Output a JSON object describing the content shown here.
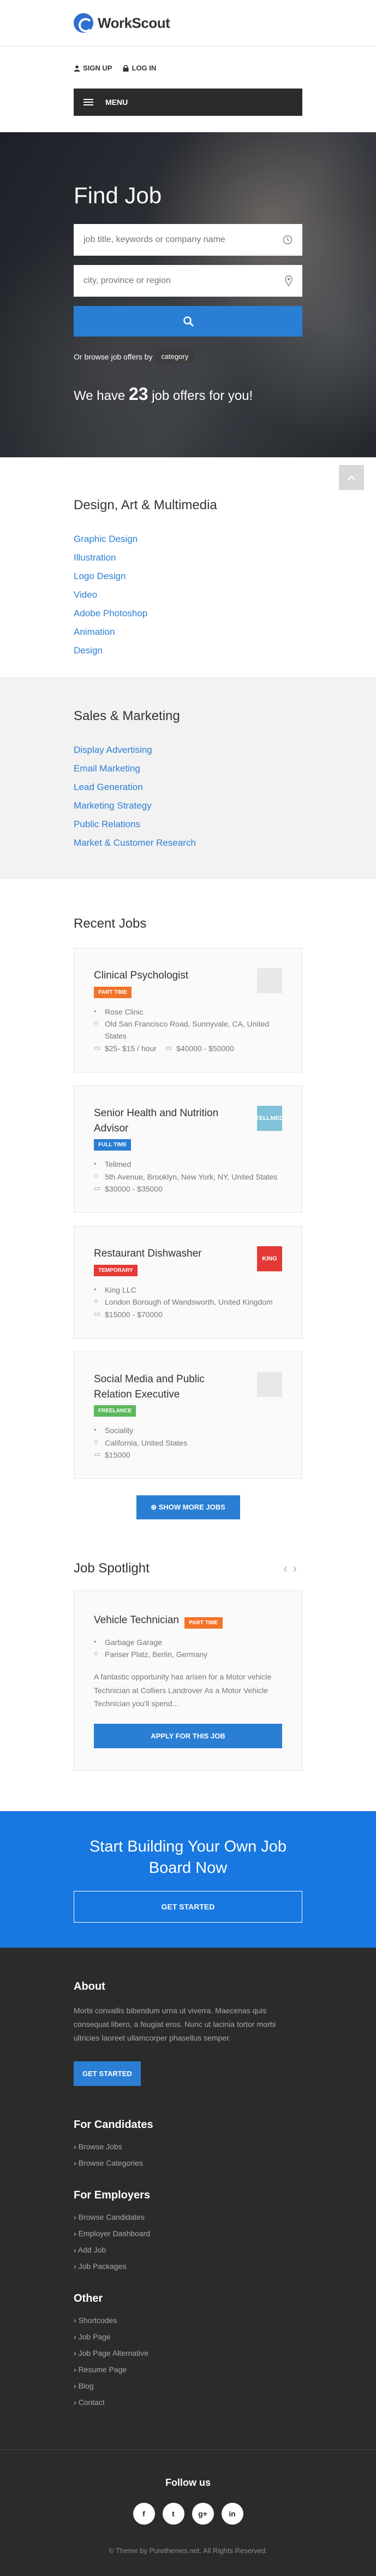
{
  "brand": {
    "name": "WorkScout"
  },
  "header": {
    "signup": "SIGN UP",
    "login": "LOG IN",
    "menu": "MENU"
  },
  "hero": {
    "title": "Find Job",
    "keyword_placeholder": "job title, keywords or company name",
    "location_placeholder": "city, province or region",
    "browse_text": "Or browse job offers by",
    "browse_pill": "category",
    "offers_prefix": "We have",
    "offers_count": "23",
    "offers_suffix": "job offers for you!"
  },
  "categories": [
    {
      "title": "Design, Art & Multimedia",
      "items": [
        "Graphic Design",
        "Illustration",
        "Logo Design",
        "Video",
        "Adobe Photoshop",
        "Animation",
        "Design"
      ]
    },
    {
      "title": "Sales & Marketing",
      "items": [
        "Display Advertising",
        "Email Marketing",
        "Lead Generation",
        "Marketing Strategy",
        "Public Relations",
        "Market & Customer Research"
      ]
    }
  ],
  "recent": {
    "title": "Recent Jobs",
    "jobs": [
      {
        "title": "Clinical Psychologist",
        "badge": "PART TIME",
        "badge_color": "#f2732a",
        "company": "Rose Clinic",
        "location": "Old San Francisco Road, Sunnyvale, CA, United States",
        "salary": "$25- $15 / hour",
        "salary2": "$40000 - $50000",
        "logo_bg": "#e8e8e8",
        "logo_text": ""
      },
      {
        "title": "Senior Health and Nutrition Advisor",
        "badge": "FULL TIME",
        "badge_color": "#2a7fd4",
        "company": "Tellmed",
        "location": "5th Avenue, Brooklyn, New York, NY, United States",
        "salary": "$30000 - $35000",
        "salary2": "",
        "logo_bg": "#7fc1d6",
        "logo_text": "TELLMED"
      },
      {
        "title": "Restaurant Dishwasher",
        "badge": "TEMPORARY",
        "badge_color": "#e53935",
        "company": "King LLC",
        "location": "London Borough of Wandsworth, United Kingdom",
        "salary": "$15000 - $70000",
        "salary2": "",
        "logo_bg": "#e53935",
        "logo_text": "KING"
      },
      {
        "title": "Social Media and Public Relation Executive",
        "badge": "FREELANCE",
        "badge_color": "#5cb85c",
        "company": "Sociality",
        "location": "California, United States",
        "salary": "$15000",
        "salary2": "",
        "logo_bg": "#e8e8e8",
        "logo_text": ""
      }
    ],
    "show_more": "SHOW MORE JOBS"
  },
  "spotlight": {
    "title": "Job Spotlight",
    "job_title": "Vehicle Technician",
    "badge": "PART TIME",
    "company": "Garbage Garage",
    "location": "Pariser Platz, Berlin, Germany",
    "description": "A fantastic opportunity has arisen for a Motor vehicle Technician at Colliers Landrover As a Motor Vehicle Technician you'll spend...",
    "apply": "APPLY FOR THIS JOB"
  },
  "cta": {
    "title": "Start Building Your Own Job Board Now",
    "button": "GET STARTED"
  },
  "footer": {
    "about_title": "About",
    "about_text": "Morbi convallis bibendum urna ut viverra. Maecenas quis consequat libero, a feugiat eros. Nunc ut lacinia tortor morbi ultricies laoreet ullamcorper phasellus semper.",
    "about_button": "GET STARTED",
    "candidates_title": "For Candidates",
    "candidates": [
      "Browse Jobs",
      "Browse Categories"
    ],
    "employers_title": "For Employers",
    "employers": [
      "Browse Candidates",
      "Employer Dashboard",
      "Add Job",
      "Job Packages"
    ],
    "other_title": "Other",
    "other": [
      "Shortcodes",
      "Job Page",
      "Job Page Alternative",
      "Resume Page",
      "Blog",
      "Contact"
    ],
    "follow": "Follow us",
    "socials": [
      "f",
      "t",
      "g+",
      "in"
    ],
    "copyright": "© Theme by Purethemes.net. All Rights Reserved."
  }
}
